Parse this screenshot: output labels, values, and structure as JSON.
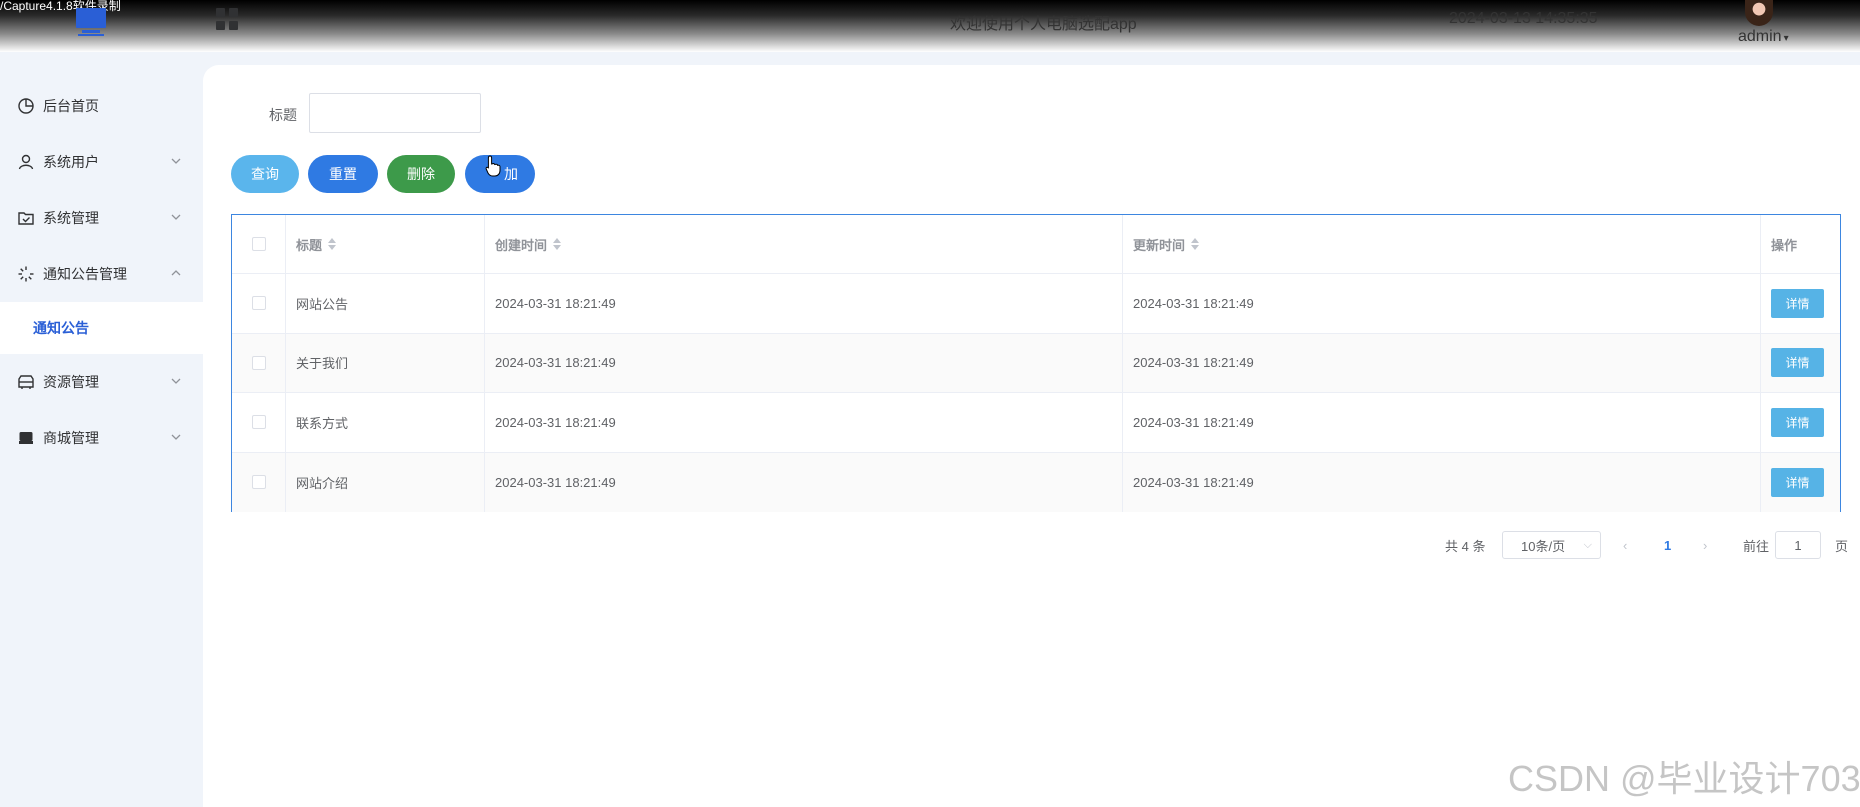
{
  "recorder": {
    "label": "/Capture4.1.8软件录制"
  },
  "topbar": {
    "welcome": "欢迎使用个人电脑选配app",
    "datetime": "2024-03-13 14:35:35",
    "username": "admin",
    "caret": "▾",
    "icons": {
      "logo": "monitor-icon",
      "menu": "grid-icon",
      "avatar": "avatar"
    }
  },
  "sidebar": {
    "items": [
      {
        "label": "后台首页",
        "icon": "pie-chart-icon",
        "expandable": false
      },
      {
        "label": "系统用户",
        "icon": "user-icon",
        "expandable": true,
        "chevron": "chevron-down-icon"
      },
      {
        "label": "系统管理",
        "icon": "checked-folder-icon",
        "expandable": true,
        "chevron": "chevron-down-icon"
      },
      {
        "label": "通知公告管理",
        "icon": "loading-icon",
        "expandable": true,
        "chevron": "chevron-up-icon",
        "expanded": true,
        "children": [
          {
            "label": "通知公告",
            "active": true
          }
        ]
      },
      {
        "label": "资源管理",
        "icon": "box-icon",
        "expandable": true,
        "chevron": "chevron-down-icon"
      },
      {
        "label": "商城管理",
        "icon": "shop-icon",
        "expandable": true,
        "chevron": "chevron-down-icon"
      }
    ],
    "accent": "#2a5fd6"
  },
  "search": {
    "label": "标题",
    "value": "",
    "placeholder": ""
  },
  "buttons": {
    "query": "查询",
    "reset": "重置",
    "delete": "删除",
    "add": "加",
    "colors": {
      "query": "#5ab5ec",
      "reset": "#2f7ae3",
      "delete": "#3d9a4a",
      "add": "#2f7ae3"
    }
  },
  "table": {
    "columns": [
      "标题",
      "创建时间",
      "更新时间",
      "操作"
    ],
    "rows": [
      {
        "title": "网站公告",
        "created": "2024-03-31 18:21:49",
        "updated": "2024-03-31 18:21:49",
        "action": "详情"
      },
      {
        "title": "关于我们",
        "created": "2024-03-31 18:21:49",
        "updated": "2024-03-31 18:21:49",
        "action": "详情"
      },
      {
        "title": "联系方式",
        "created": "2024-03-31 18:21:49",
        "updated": "2024-03-31 18:21:49",
        "action": "详情"
      },
      {
        "title": "网站介绍",
        "created": "2024-03-31 18:21:49",
        "updated": "2024-03-31 18:21:49",
        "action": "详情"
      }
    ]
  },
  "pagination": {
    "total": "共 4 条",
    "page_size": "10条/页",
    "prev": "‹",
    "current": "1",
    "next": "›",
    "goto_label": "前往",
    "goto_value": "1",
    "page_suffix": "页"
  },
  "watermark": "CSDN @毕业设计703"
}
